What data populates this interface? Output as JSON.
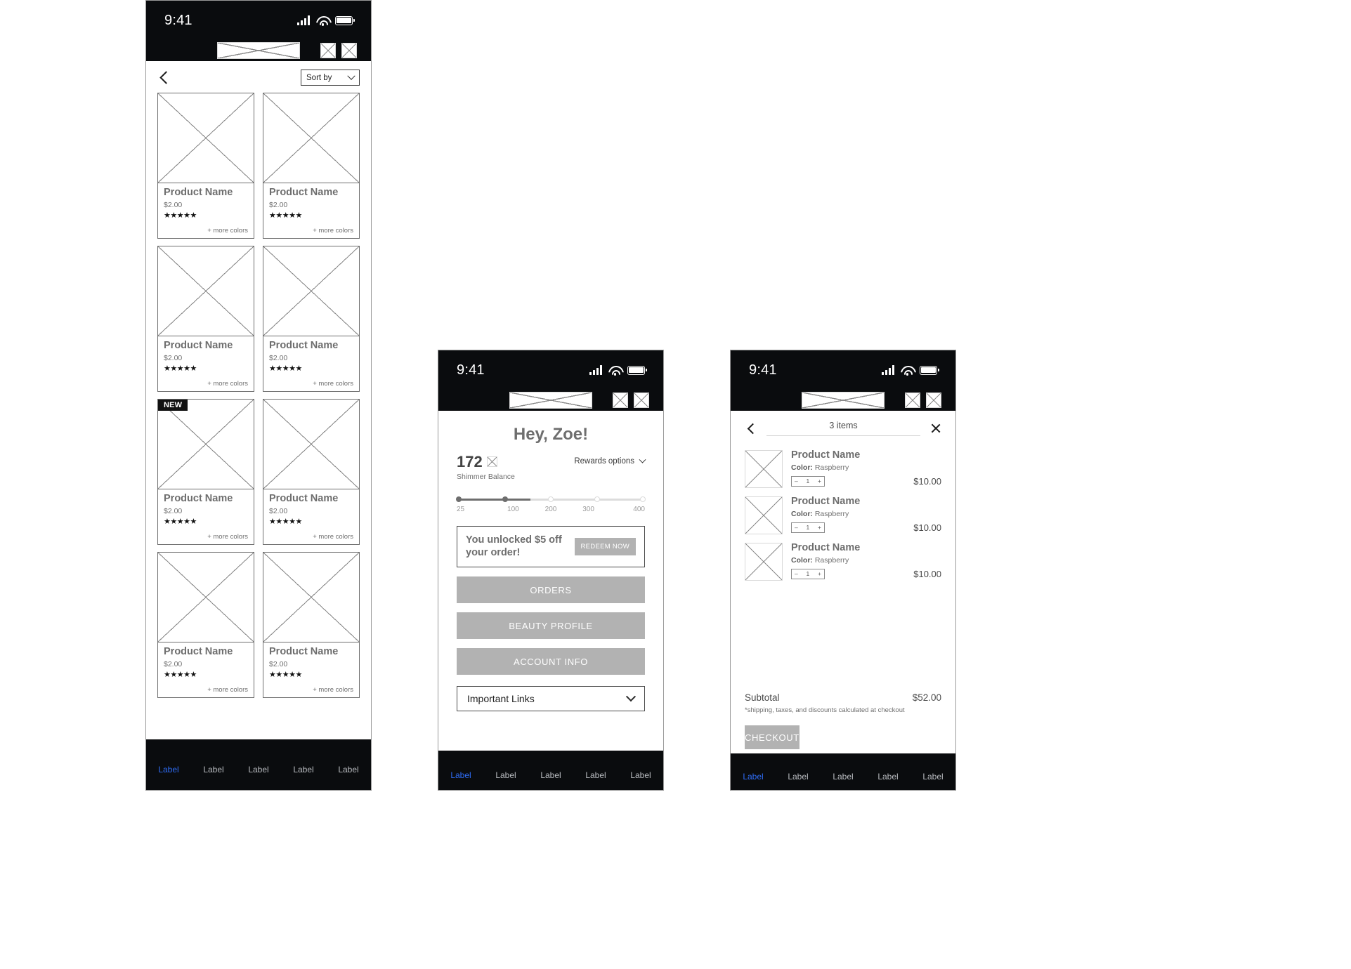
{
  "status_bar": {
    "time": "9:41",
    "signal_icon": "signal-bars-icon",
    "wifi_icon": "wifi-icon",
    "battery_icon": "battery-icon"
  },
  "shared": {
    "logo_placeholder": "logo-placeholder",
    "appbar_icon_1": "search-icon-placeholder",
    "appbar_icon_2": "cart-icon-placeholder",
    "tab_labels": [
      "Label",
      "Label",
      "Label",
      "Label",
      "Label"
    ],
    "active_tab_index": 0,
    "accent_color": "#2f6df6",
    "button_gray": "#b2b2b2",
    "text_gray": "#6e6e6e"
  },
  "product_grid_screen": {
    "back_label": "back",
    "sort": {
      "label": "Sort by",
      "chevron": "chevron-down-icon"
    },
    "products": [
      {
        "badge": null,
        "name": "Product Name",
        "price": "$2.00",
        "stars": "★★★★★",
        "more_colors": "+ more colors"
      },
      {
        "badge": null,
        "name": "Product Name",
        "price": "$2.00",
        "stars": "★★★★★",
        "more_colors": "+ more colors"
      },
      {
        "badge": null,
        "name": "Product Name",
        "price": "$2.00",
        "stars": "★★★★★",
        "more_colors": "+ more colors"
      },
      {
        "badge": null,
        "name": "Product Name",
        "price": "$2.00",
        "stars": "★★★★★",
        "more_colors": "+ more colors"
      },
      {
        "badge": "NEW",
        "name": "Product Name",
        "price": "$2.00",
        "stars": "★★★★★",
        "more_colors": "+ more colors"
      },
      {
        "badge": null,
        "name": "Product Name",
        "price": "$2.00",
        "stars": "★★★★★",
        "more_colors": "+ more colors"
      },
      {
        "badge": null,
        "name": "Product Name",
        "price": "$2.00",
        "stars": "★★★★★",
        "more_colors": "+ more colors"
      },
      {
        "badge": null,
        "name": "Product Name",
        "price": "$2.00",
        "stars": "★★★★★",
        "more_colors": "+ more colors"
      }
    ]
  },
  "account_screen": {
    "greeting": "Hey, Zoe!",
    "balance_value": "172",
    "balance_icon": "currency-icon-placeholder",
    "balance_label": "Shimmer Balance",
    "rewards_options": {
      "label": "Rewards options",
      "chevron": "chevron-down-icon"
    },
    "progress": {
      "current": 172,
      "min": 25,
      "max": 400,
      "ticks": [
        "25",
        "100",
        "200",
        "300",
        "400"
      ],
      "filled_ticks": [
        true,
        true,
        false,
        false,
        false
      ]
    },
    "unlock_banner": {
      "text": "You unlocked $5 off your order!",
      "button": "REDEEM NOW"
    },
    "menu_buttons": [
      "ORDERS",
      "BEAUTY PROFILE",
      "ACCOUNT INFO"
    ],
    "links_select": {
      "label": "Important Links",
      "chevron": "chevron-down-icon"
    }
  },
  "cart_screen": {
    "back_label": "back",
    "title": "3 items",
    "close_label": "close",
    "items": [
      {
        "thumb": "product-image-placeholder",
        "name": "Product Name",
        "color_label": "Color:",
        "color_value": "Raspberry",
        "qty": "1",
        "minus": "–",
        "plus": "+",
        "price": "$10.00"
      },
      {
        "thumb": "product-image-placeholder",
        "name": "Product Name",
        "color_label": "Color:",
        "color_value": "Raspberry",
        "qty": "1",
        "minus": "–",
        "plus": "+",
        "price": "$10.00"
      },
      {
        "thumb": "product-image-placeholder",
        "name": "Product Name",
        "color_label": "Color:",
        "color_value": "Raspberry",
        "qty": "1",
        "minus": "–",
        "plus": "+",
        "price": "$10.00"
      }
    ],
    "subtotal_label": "Subtotal",
    "subtotal_value": "$52.00",
    "note": "*shipping, taxes, and discounts calculated at checkout",
    "checkout_label": "CHECKOUT"
  }
}
